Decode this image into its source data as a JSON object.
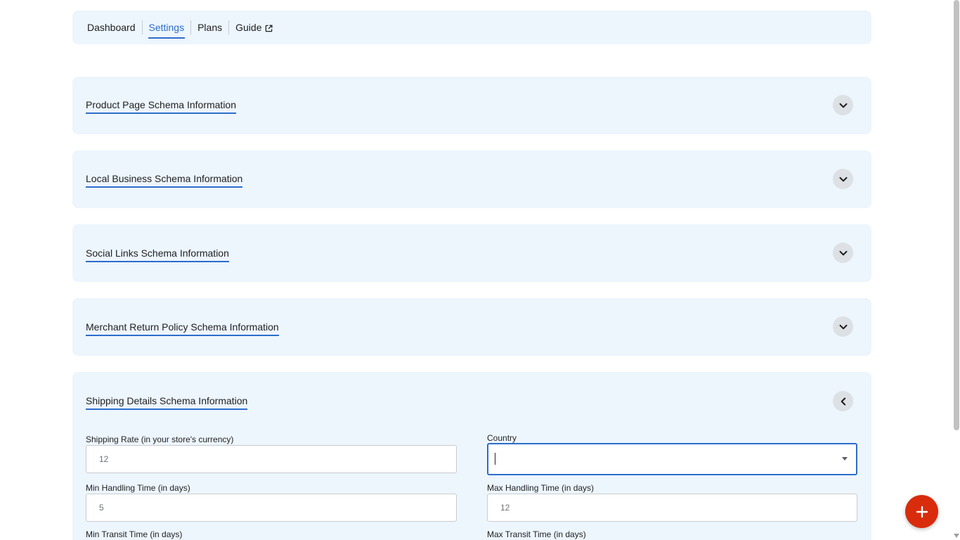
{
  "nav": {
    "items": [
      {
        "label": "Dashboard"
      },
      {
        "label": "Settings"
      },
      {
        "label": "Plans"
      },
      {
        "label": "Guide"
      }
    ],
    "active": "Settings"
  },
  "sections": [
    {
      "title": "Product Page Schema Information",
      "expanded": false
    },
    {
      "title": "Local Business Schema Information",
      "expanded": false
    },
    {
      "title": "Social Links Schema Information",
      "expanded": false
    },
    {
      "title": "Merchant Return Policy Schema Information",
      "expanded": false
    },
    {
      "title": "Shipping Details Schema Information",
      "expanded": true
    }
  ],
  "shipping_form": {
    "shipping_rate": {
      "label": "Shipping Rate (in your store's currency)",
      "value": "12"
    },
    "country": {
      "label": "Country",
      "value": ""
    },
    "min_handling": {
      "label": "Min Handling Time (in days)",
      "value": "5"
    },
    "max_handling": {
      "label": "Max Handling Time (in days)",
      "value": "12"
    },
    "min_transit": {
      "label": "Min Transit Time (in days)"
    },
    "max_transit": {
      "label": "Max Transit Time (in days)"
    }
  },
  "colors": {
    "panel_bg": "#edf5fd",
    "accent": "#2c6ecb",
    "fab": "#d82c0d"
  },
  "icons": {
    "expand": "chevron-down-icon",
    "collapse": "chevron-left-icon",
    "external": "external-link-icon",
    "fab": "plus-icon"
  }
}
